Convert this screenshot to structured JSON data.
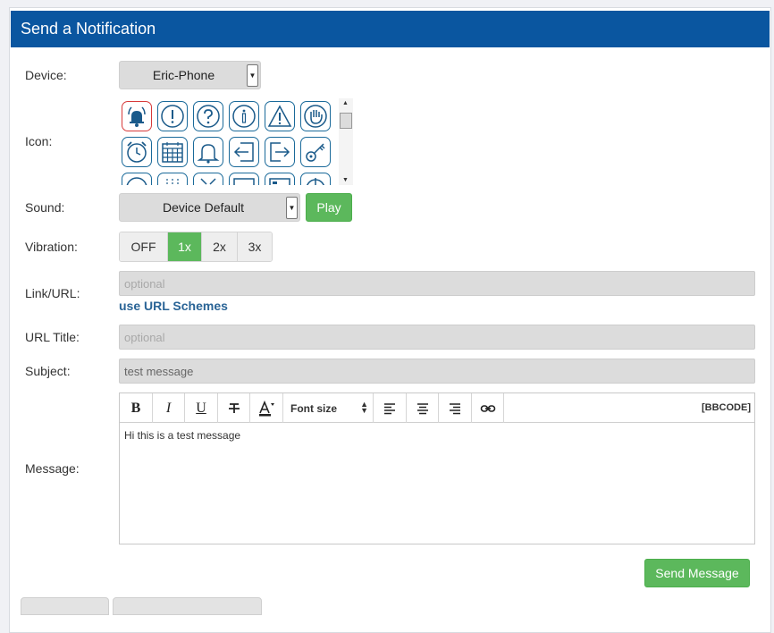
{
  "header": {
    "title": "Send a Notification"
  },
  "form": {
    "device": {
      "label": "Device:",
      "value": "Eric-Phone"
    },
    "icon": {
      "label": "Icon:",
      "items": [
        "bell-alert-icon",
        "exclamation-icon",
        "question-icon",
        "info-icon",
        "warning-icon",
        "hand-stop-icon",
        "alarm-clock-icon",
        "calendar-icon",
        "bell-icon",
        "sign-in-icon",
        "sign-out-icon",
        "key-icon",
        "clock-icon",
        "grid-icon",
        "tools-icon",
        "monitor-icon",
        "display-icon",
        "power-icon"
      ],
      "selected": "bell-alert-icon"
    },
    "sound": {
      "label": "Sound:",
      "value": "Device Default",
      "play_label": "Play"
    },
    "vibration": {
      "label": "Vibration:",
      "options": [
        "OFF",
        "1x",
        "2x",
        "3x"
      ],
      "selected": "1x"
    },
    "link": {
      "label": "Link/URL:",
      "placeholder": "optional",
      "help_link": "use URL Schemes"
    },
    "url_title": {
      "label": "URL Title:",
      "placeholder": "optional"
    },
    "subject": {
      "label": "Subject:",
      "value": "test message"
    },
    "message": {
      "label": "Message:",
      "toolbar": {
        "font_size_label": "Font size",
        "bbcode_label": "[BBCODE]"
      },
      "body": "Hi this is a test message"
    },
    "send_label": "Send Message"
  },
  "colors": {
    "header_bg": "#0a56a0",
    "success": "#5cb85c",
    "link": "#2a6496",
    "icon_border": "#1a6a9a",
    "selected_icon_border": "#d73a3a"
  }
}
